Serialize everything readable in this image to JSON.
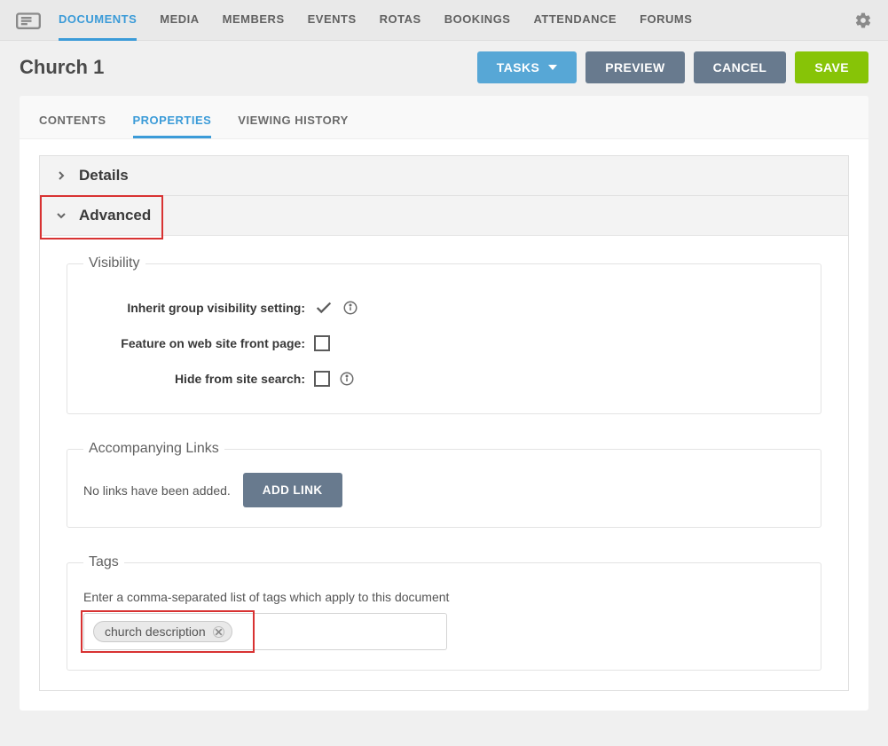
{
  "topnav": {
    "items": [
      "DOCUMENTS",
      "MEDIA",
      "MEMBERS",
      "EVENTS",
      "ROTAS",
      "BOOKINGS",
      "ATTENDANCE",
      "FORUMS"
    ],
    "active_index": 0
  },
  "page": {
    "title": "Church 1"
  },
  "actions": {
    "tasks": "TASKS",
    "preview": "PREVIEW",
    "cancel": "CANCEL",
    "save": "SAVE"
  },
  "subtabs": {
    "items": [
      "CONTENTS",
      "PROPERTIES",
      "VIEWING HISTORY"
    ],
    "active_index": 1
  },
  "accordion": {
    "details": {
      "title": "Details"
    },
    "advanced": {
      "title": "Advanced"
    }
  },
  "visibility": {
    "legend": "Visibility",
    "inherit_label": "Inherit group visibility setting:",
    "feature_label": "Feature on web site front page:",
    "hide_label": "Hide from site search:",
    "inherit_checked": true,
    "feature_checked": false,
    "hide_checked": false
  },
  "links": {
    "legend": "Accompanying Links",
    "empty_text": "No links have been added.",
    "add_button": "ADD LINK"
  },
  "tags": {
    "legend": "Tags",
    "hint": "Enter a comma-separated list of tags which apply to this document",
    "items": [
      "church description"
    ]
  }
}
